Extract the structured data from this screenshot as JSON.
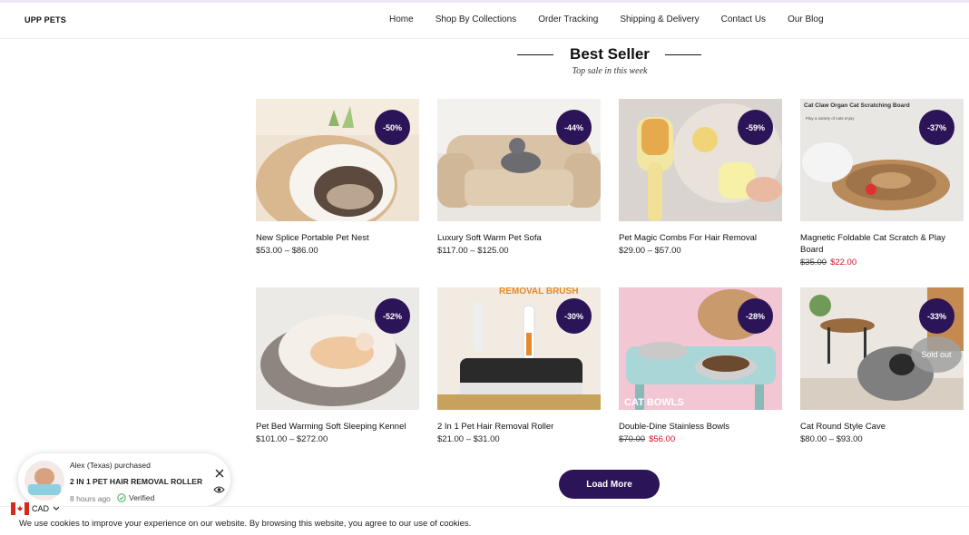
{
  "header": {
    "logo": "UPP PETS",
    "nav": [
      "Home",
      "Shop By Collections",
      "Order Tracking",
      "Shipping & Delivery",
      "Contact Us",
      "Our Blog"
    ]
  },
  "section": {
    "title": "Best Seller",
    "subtitle": "Top sale in this week"
  },
  "products": [
    {
      "name": "New Splice Portable Pet Nest",
      "price": "$53.00 – $86.00",
      "old_price": "",
      "sale_price": "",
      "badge": "-50%",
      "sold_out": ""
    },
    {
      "name": "Luxury Soft Warm Pet Sofa",
      "price": "$117.00 – $125.00",
      "old_price": "",
      "sale_price": "",
      "badge": "-44%",
      "sold_out": ""
    },
    {
      "name": "Pet Magic Combs For Hair Removal",
      "price": "$29.00 – $57.00",
      "old_price": "",
      "sale_price": "",
      "badge": "-59%",
      "sold_out": ""
    },
    {
      "name": "Magnetic Foldable Cat Scratch & Play Board",
      "price": "",
      "old_price": "$35.00",
      "sale_price": "$22.00",
      "badge": "-37%",
      "sold_out": "",
      "image_caption": "Cat Claw Organ Cat Scratching Board",
      "image_caption2": "Play a variety of cats enjoy"
    },
    {
      "name": "Pet Bed Warming Soft Sleeping Kennel",
      "price": "$101.00 – $272.00",
      "old_price": "",
      "sale_price": "",
      "badge": "-52%",
      "sold_out": ""
    },
    {
      "name": "2 In 1 Pet Hair Removal Roller",
      "price": "$21.00 – $31.00",
      "old_price": "",
      "sale_price": "",
      "badge": "-30%",
      "sold_out": "",
      "image_caption": "REMOVAL BRUSH"
    },
    {
      "name": "Double-Dine Stainless Bowls",
      "price": "",
      "old_price": "$70.00",
      "sale_price": "$56.00",
      "badge": "-28%",
      "sold_out": "",
      "image_caption": "CAT BOWLS"
    },
    {
      "name": "Cat Round Style Cave",
      "price": "$80.00 – $93.00",
      "old_price": "",
      "sale_price": "",
      "badge": "-33%",
      "sold_out": "Sold out"
    }
  ],
  "load_more": "Load More",
  "popup": {
    "who": "Alex (Texas) purchased",
    "product": "2 IN 1 PET HAIR REMOVAL ROLLER",
    "time": "8 hours ago",
    "verified": "Verified"
  },
  "currency": "CAD",
  "cookie_text": "We use cookies to improve your experience on our website. By browsing this website, you agree to our use of cookies.",
  "colors": {
    "accent": "#2b1457",
    "sale": "#d1102a"
  },
  "icons": [
    "close-icon",
    "eye-icon",
    "check-circle-icon",
    "canada-flag-icon",
    "chevron-down-icon"
  ]
}
